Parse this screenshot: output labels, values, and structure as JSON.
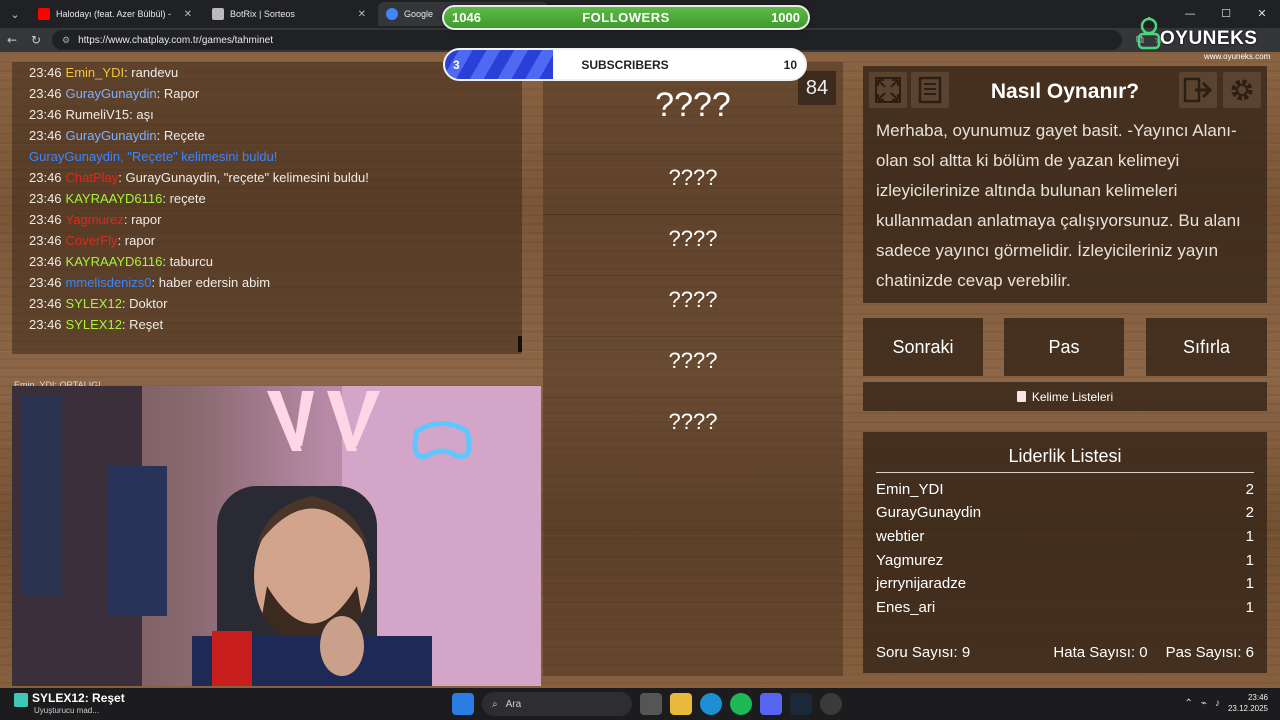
{
  "browser": {
    "tabs": [
      {
        "label": "Halodayı (feat. Azer Bülbül) -",
        "icon_color": "#ff0000",
        "active": false
      },
      {
        "label": "BotRix | Sorteos",
        "icon_color": "#bbbbbb",
        "active": false
      },
      {
        "label": "Google",
        "icon_color": "#4285f4",
        "active": true
      }
    ],
    "url": "https://www.chatplay.com.tr/games/tahminet",
    "window_controls": [
      "—",
      "☐",
      "✕"
    ]
  },
  "followers": {
    "left": "1046",
    "title": "FOLLOWERS",
    "right": "1000",
    "fill_fraction": 1.0
  },
  "subscribers": {
    "left": "3",
    "title": "SUBSCRIBERS",
    "right": "10",
    "fill_fraction": 0.3
  },
  "logo": {
    "text": "OYUNEKS",
    "url": "www.oyuneks.com"
  },
  "chat": [
    {
      "time": "23:46",
      "user": "Emin_YDI",
      "user_color": "#f2c33a",
      "message": ": randevu"
    },
    {
      "time": "23:46",
      "user": "GurayGunaydin",
      "user_color": "#7fb0ff",
      "message": ": Rapor"
    },
    {
      "time": "23:46",
      "user": "RumeliV15",
      "user_color": "#f0ece6",
      "message": ": aşı"
    },
    {
      "time": "23:46",
      "user": "GurayGunaydin",
      "user_color": "#7fb0ff",
      "message": ": Reçete"
    },
    {
      "time": "",
      "user": "GurayGunaydin, \"Reçete\" kelimesini buldu!",
      "user_color": "#3a86ff",
      "message": ""
    },
    {
      "time": "23:46",
      "user": "ChatPlay",
      "user_color": "#e0281e",
      "message": ": GurayGunaydin, \"reçete\" kelimesini buldu!"
    },
    {
      "time": "23:46",
      "user": "KAYRAAYD6116",
      "user_color": "#a6f53a",
      "message": ": reçete"
    },
    {
      "time": "23:46",
      "user": "Yagmurez",
      "user_color": "#e0281e",
      "message": ": rapor"
    },
    {
      "time": "23:46",
      "user": "CoverFly",
      "user_color": "#e0281e",
      "message": ": rapor"
    },
    {
      "time": "23:46",
      "user": "KAYRAAYD6116",
      "user_color": "#a6f53a",
      "message": ": taburcu"
    },
    {
      "time": "23:46",
      "user": "mmelisdenizs0",
      "user_color": "#3a86ff",
      "message": ": haber edersin abim"
    },
    {
      "time": "23:46",
      "user": "SYLEX12",
      "user_color": "#a6f53a",
      "message": ": Doktor"
    },
    {
      "time": "23:46",
      "user": "SYLEX12",
      "user_color": "#a6f53a",
      "message": ": Reşet"
    }
  ],
  "cam_overlay": "Emin_YDI: ORTALIG!",
  "timer": "84",
  "words": [
    "????",
    "????",
    "????",
    "????",
    "????",
    "????"
  ],
  "howto": {
    "title": "Nasıl Oynanır?",
    "text": "Merhaba, oyunumuz gayet basit. -Yayıncı Alanı- olan sol altta ki bölüm de yazan kelimeyi izleyicilerinize altında bulunan kelimeleri kullanmadan anlatmaya çalışıyorsunuz. Bu alanı sadece yayıncı görmelidir. İzleyicileriniz yayın chatinizde cevap verebilir."
  },
  "buttons": {
    "next": "Sonraki",
    "pass": "Pas",
    "reset": "Sıfırla",
    "word_lists": "Kelime Listeleri"
  },
  "leaderboard": {
    "title": "Liderlik Listesi",
    "rows": [
      {
        "name": "Emin_YDI",
        "score": "2"
      },
      {
        "name": "GurayGunaydin",
        "score": "2"
      },
      {
        "name": "webtier",
        "score": "1"
      },
      {
        "name": "Yagmurez",
        "score": "1"
      },
      {
        "name": "jerrynijaradze",
        "score": "1"
      },
      {
        "name": "Enes_ari",
        "score": "1"
      }
    ],
    "stats": {
      "questions": "Soru Sayısı: 9",
      "errors": "Hata Sayısı: 0",
      "passes": "Pas Sayısı: 6"
    }
  },
  "taskbar": {
    "notification_title": "SYLEX12: Reşet",
    "notification_sub": "Uyuşturucu mad...",
    "search_placeholder": "Ara",
    "time": "23:46",
    "date": "23.12.2025"
  }
}
